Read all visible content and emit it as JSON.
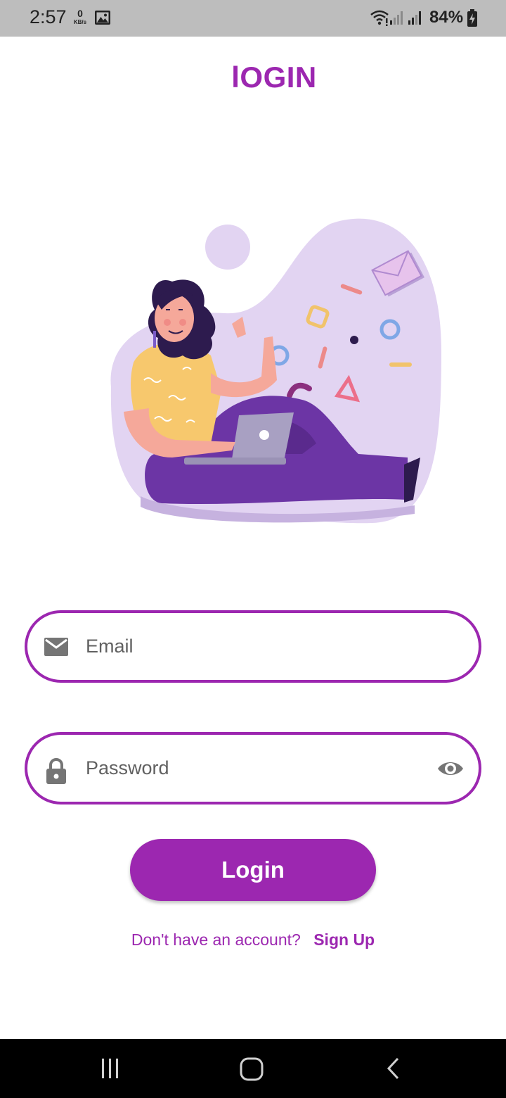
{
  "status_bar": {
    "time": "2:57",
    "net_speed_value": "0",
    "net_speed_unit": "KB/s",
    "battery_percent": "84%",
    "icons": [
      "gallery-icon",
      "wifi-icon",
      "signal-icon",
      "signal-icon",
      "battery-charging-icon"
    ]
  },
  "header": {
    "title": "lOGIN"
  },
  "illustration": {
    "icon": "woman-with-laptop-illustration"
  },
  "form": {
    "email": {
      "placeholder": "Email",
      "icon": "mail-icon"
    },
    "password": {
      "placeholder": "Password",
      "icon": "lock-icon",
      "toggle_icon": "eye-icon"
    },
    "login_label": "Login"
  },
  "signup": {
    "prompt": "Don't have an account?",
    "link_label": "Sign Up"
  },
  "nav_bar": {
    "icons": [
      "recent-apps-icon",
      "home-icon",
      "back-icon"
    ]
  },
  "colors": {
    "accent": "#9c27b0",
    "status_bar": "#bdbdbd",
    "nav_bar": "#000000",
    "blob": "#e2d4f2",
    "pants": "#6c35a5"
  }
}
